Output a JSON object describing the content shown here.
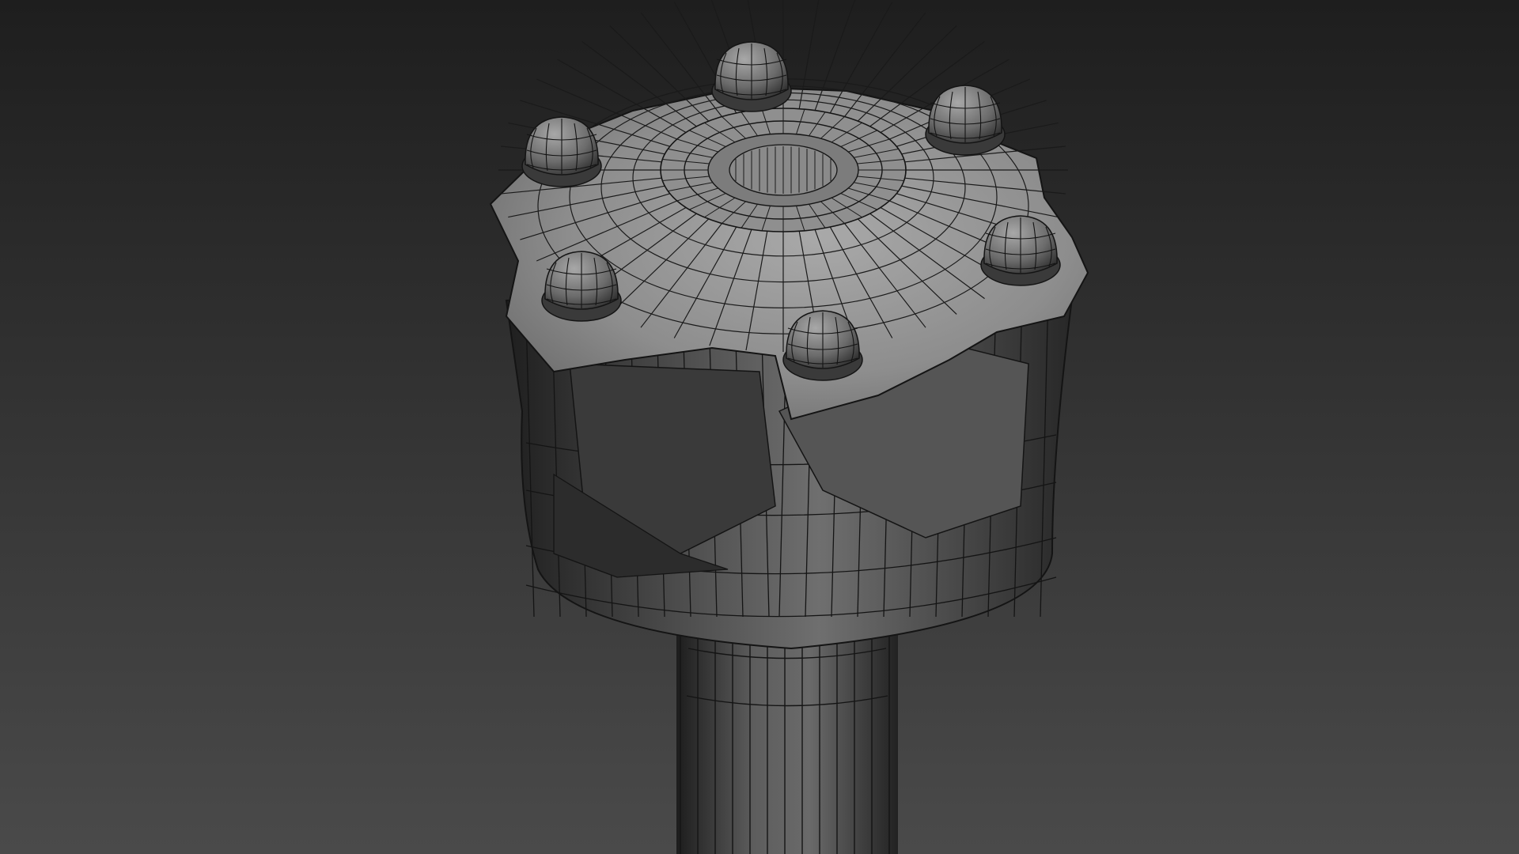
{
  "scene": {
    "subject": "wireframe-mace-model",
    "colors": {
      "background_top": "#1e1e1e",
      "background_bottom": "#4a4a4a",
      "surface_light": "#9e9e9e",
      "surface_mid": "#6d6d6d",
      "surface_dark": "#2f2f2f",
      "wire": "#151515"
    }
  }
}
